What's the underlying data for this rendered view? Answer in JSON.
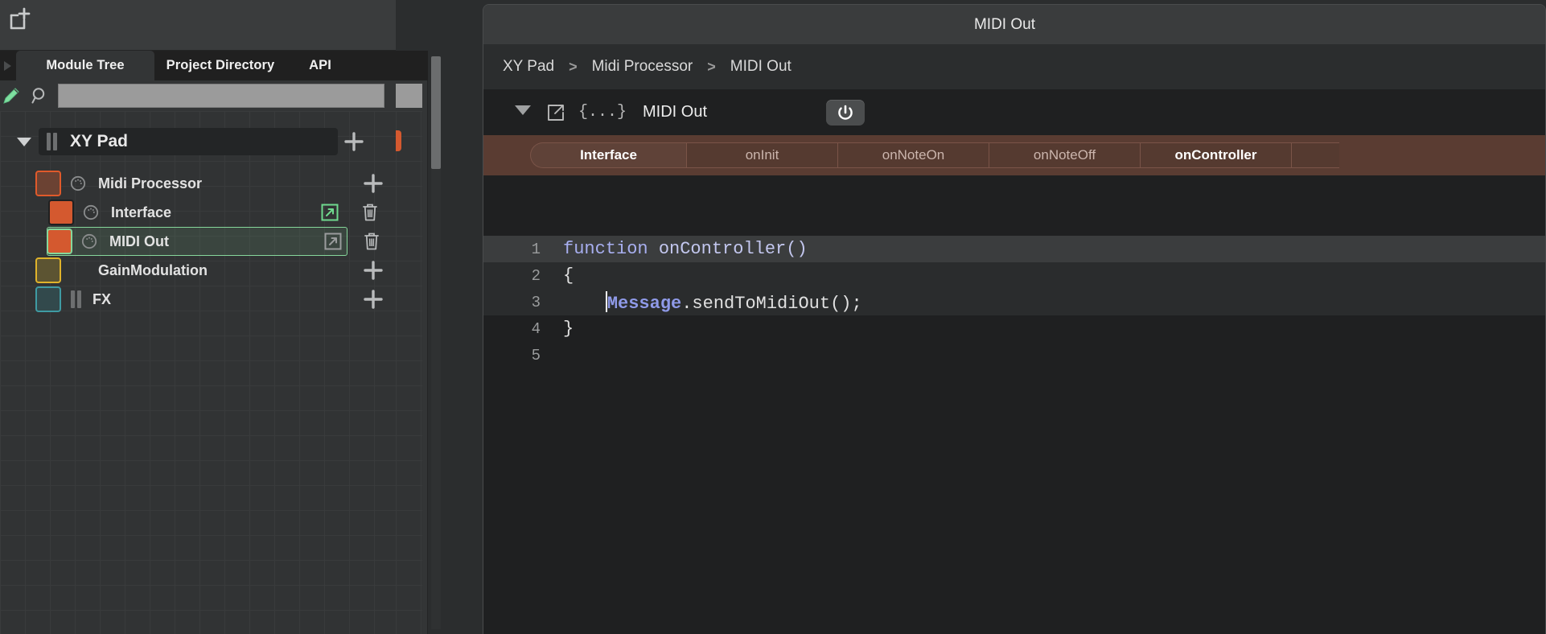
{
  "left_panel": {
    "toolbar": {
      "new_module_icon": "new-module-icon"
    },
    "tabs": [
      {
        "id": "module-tree",
        "label": "Module Tree",
        "active": true
      },
      {
        "id": "project-directory",
        "label": "Project Directory",
        "active": false
      },
      {
        "id": "api",
        "label": "API",
        "active": false
      }
    ],
    "search": {
      "value": "",
      "placeholder": ""
    },
    "tree": {
      "root": {
        "label": "XY Pad",
        "expanded": true,
        "icon": "bars-icon",
        "add_icon": "plus-icon"
      },
      "items": [
        {
          "label": "Midi Processor",
          "swatch": "#6b4233",
          "swatch_border": "#e05a2b",
          "knob": true,
          "indent": 0,
          "right_icon": "plus-icon"
        },
        {
          "label": "Interface",
          "swatch": "#d4592f",
          "swatch_border": "#1f2021",
          "knob": true,
          "indent": 1,
          "right_icon": "external-link-icon",
          "right_icon2": "trash-icon",
          "link_color": "#6fd98e"
        },
        {
          "label": "MIDI Out",
          "swatch": "#d4592f",
          "swatch_border": "#86d79b",
          "knob": true,
          "indent": 1,
          "selected": true,
          "right_icon": "external-link-icon",
          "right_icon2": "trash-icon",
          "link_color": "#9a9c9d"
        },
        {
          "label": "GainModulation",
          "swatch": "#5c5432",
          "swatch_border": "#e0b32b",
          "knob": false,
          "indent": 0,
          "right_icon": "plus-icon"
        },
        {
          "label": "FX",
          "swatch": "#32494c",
          "swatch_border": "#3f9ba3",
          "knob": false,
          "bars": true,
          "indent": 0,
          "right_icon": "plus-icon"
        }
      ]
    }
  },
  "right_panel": {
    "window_title": "MIDI Out",
    "breadcrumb": [
      {
        "label": "XY Pad"
      },
      {
        "sep": ">"
      },
      {
        "label": "Midi Processor"
      },
      {
        "sep": ">"
      },
      {
        "label": "MIDI Out"
      }
    ],
    "module_header": {
      "disclosure_icon": "triangle-down-icon",
      "popout_icon": "external-link-icon",
      "braces_icon": "{...}",
      "title": "MIDI Out",
      "power_icon": "power-icon"
    },
    "callback_tabs": [
      {
        "label": "Interface",
        "active": true
      },
      {
        "label": "onInit",
        "active": false
      },
      {
        "label": "onNoteOn",
        "active": false
      },
      {
        "label": "onNoteOff",
        "active": false
      },
      {
        "label": "onController",
        "active": false,
        "selected": true
      }
    ],
    "editor": {
      "accent_color": "#8f9ae8",
      "lines": [
        {
          "num": "1",
          "highlight": "full",
          "tokens": [
            {
              "t": "function ",
              "c": "kw"
            },
            {
              "t": "onController()",
              "c": "fn"
            }
          ]
        },
        {
          "num": "2",
          "highlight": "partial",
          "tokens": [
            {
              "t": "{",
              "c": "plain"
            }
          ]
        },
        {
          "num": "3",
          "highlight": "partial",
          "caret": true,
          "tokens": [
            {
              "t": "    ",
              "c": "plain"
            },
            {
              "t": "Message",
              "c": "obj"
            },
            {
              "t": ".sendToMidiOut();",
              "c": "plain"
            }
          ]
        },
        {
          "num": "4",
          "highlight": "none",
          "tokens": [
            {
              "t": "}",
              "c": "plain"
            }
          ]
        },
        {
          "num": "5",
          "highlight": "none",
          "tokens": []
        }
      ]
    }
  },
  "colors": {
    "orange": "#d4592f",
    "green_select": "#86d79b",
    "tab_brown": "#5a3c32",
    "panel_dark": "#1f2021"
  }
}
